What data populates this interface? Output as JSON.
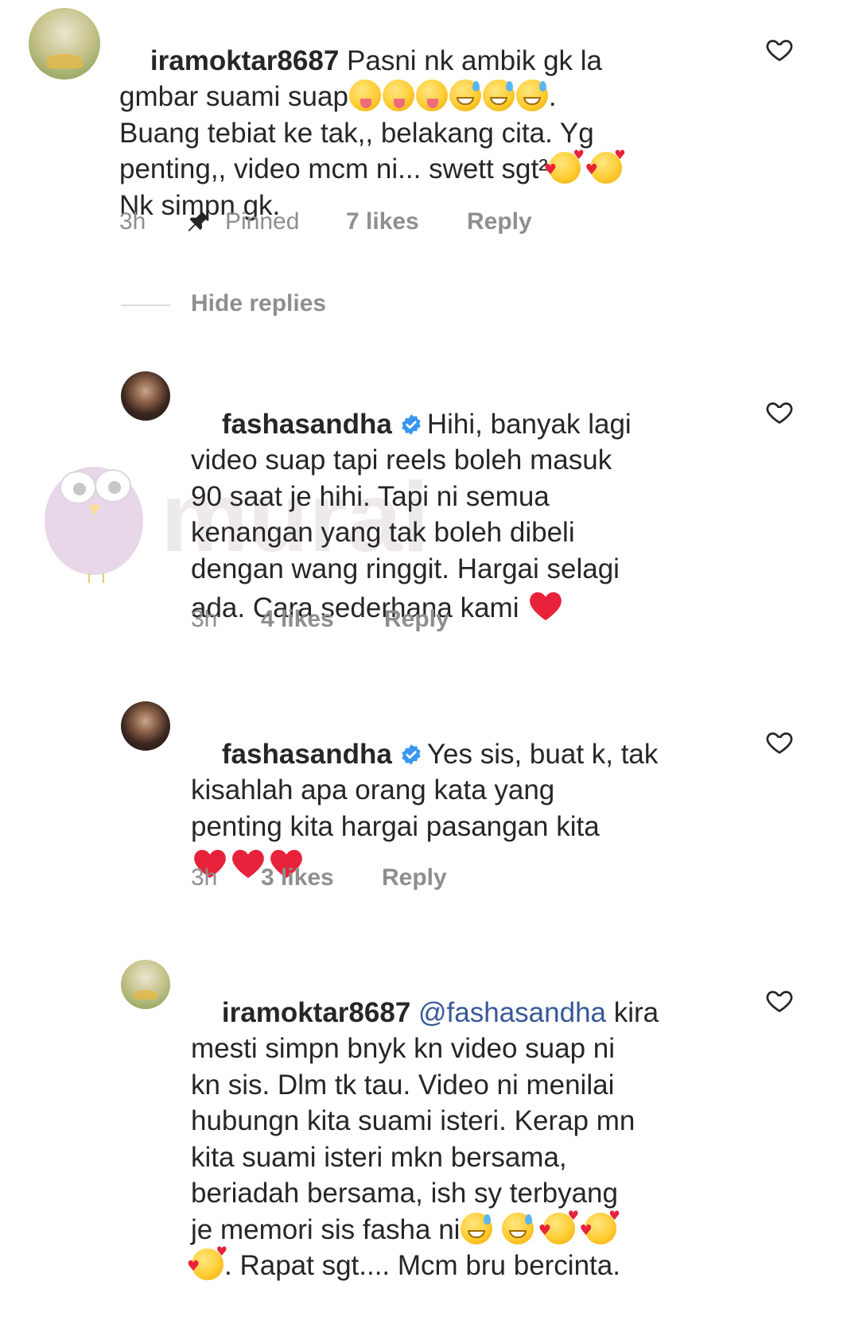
{
  "comments": [
    {
      "username": "iramoktar8687",
      "lines": [
        "Pasni nk ambik gk la",
        "gmbar suami suap",
        "Buang tebiat ke tak,, belakang cita. Yg",
        "penting,, video mcm ni... swett sgt²",
        "Nk simpn gk."
      ],
      "line2_suffix": ".",
      "time": "3h",
      "pinned_label": "Pinned",
      "likes": "7 likes",
      "reply_label": "Reply",
      "emojis": [
        "tongue-wink",
        "tongue-wink",
        "tongue-wink",
        "grin-sweat",
        "grin-sweat",
        "grin-sweat",
        "smiling-face-with-hearts",
        "smiling-face-with-hearts"
      ]
    }
  ],
  "hide_replies_label": "Hide replies",
  "replies": [
    {
      "username": "fashasandha",
      "verified": true,
      "lines": [
        "Hihi, banyak lagi",
        "video suap tapi reels boleh masuk",
        "90 saat je hihi. Tapi ni semua",
        "kenangan yang tak boleh dibeli",
        "dengan wang ringgit. Hargai selagi",
        "ada. Cara sederhana kami"
      ],
      "time": "3h",
      "likes": "4 likes",
      "reply_label": "Reply",
      "emojis": [
        "red-heart"
      ]
    },
    {
      "username": "fashasandha",
      "verified": true,
      "lines": [
        "Yes sis, buat k, tak",
        "kisahlah apa orang kata yang",
        "penting kita hargai pasangan kita"
      ],
      "time": "3h",
      "likes": "3 likes",
      "reply_label": "Reply",
      "emojis": [
        "red-heart",
        "red-heart",
        "red-heart"
      ]
    },
    {
      "username": "iramoktar8687",
      "verified": false,
      "mention": "@fashasandha",
      "lines": [
        "kira",
        "mesti simpn bnyk kn video suap ni",
        "kn sis. Dlm tk tau. Video ni menilai",
        "hubungn kita suami isteri. Kerap mn",
        "kita suami isteri mkn bersama,",
        "beriadah bersama, ish sy terbyang",
        "je memori sis fasha ni",
        ". Rapat sgt.... Mcm bru bercinta."
      ],
      "emojis": [
        "grin-sweat",
        "grin-sweat",
        "smiling-face-with-hearts",
        "smiling-face-with-hearts",
        "smiling-face-with-hearts"
      ]
    }
  ],
  "watermark_text": "murai",
  "colors": {
    "text": "#262626",
    "meta": "#8e8e8e",
    "mention": "#385898",
    "verified": "#3897f0",
    "heart": "#e8223a"
  },
  "icons": [
    "heart-outline-icon",
    "pin-icon",
    "verified-badge-icon"
  ]
}
